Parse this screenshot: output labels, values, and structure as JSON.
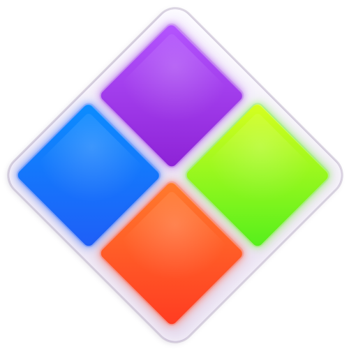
{
  "icon": {
    "name": "four-color-diamond-app-icon",
    "frame_colors": [
      "#fbf9ff",
      "#f0eaf7",
      "#e6ddf0"
    ],
    "tiles": [
      {
        "name": "purple",
        "colors": [
          "#b455ff",
          "#8d22d6"
        ],
        "glow": "#9b32e6"
      },
      {
        "name": "blue",
        "colors": [
          "#0b8dff",
          "#1f5ef7"
        ],
        "glow": "#1d63ff"
      },
      {
        "name": "green",
        "colors": [
          "#d8ff1f",
          "#54ef1c"
        ],
        "glow": "#6bf21c"
      },
      {
        "name": "orange",
        "colors": [
          "#ff7b2d",
          "#ff3b21"
        ],
        "glow": "#ff4d2b"
      }
    ]
  }
}
